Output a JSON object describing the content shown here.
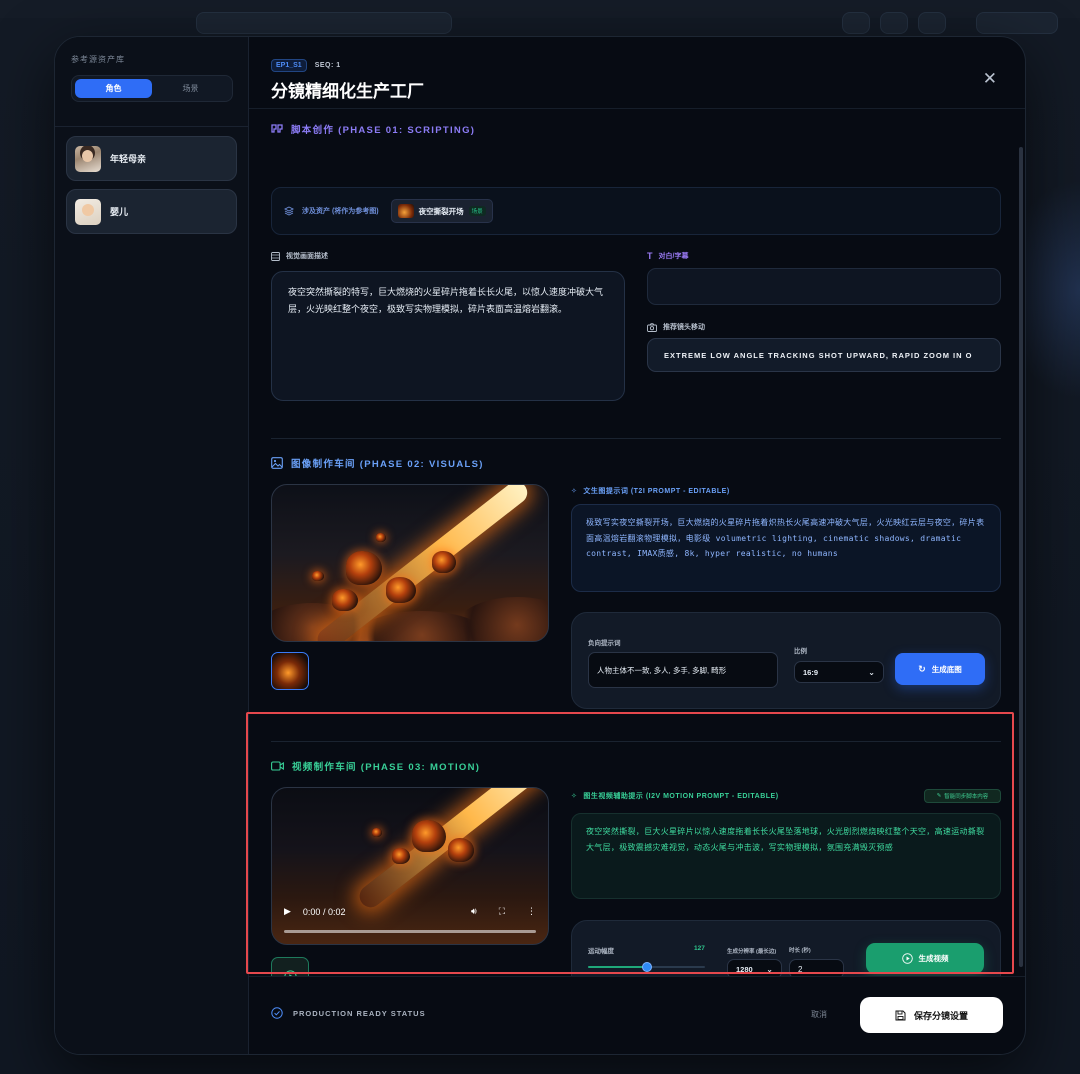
{
  "sidebar": {
    "title": "参考源资产库",
    "tabs": [
      {
        "label": "角色",
        "active": true
      },
      {
        "label": "场景",
        "active": false
      }
    ],
    "assets": [
      {
        "name": "年轻母亲",
        "icon": "avatar-mother"
      },
      {
        "name": "婴儿",
        "icon": "avatar-baby"
      }
    ]
  },
  "header": {
    "ep_badge": "EP1_S1",
    "seq": "SEQ: 1",
    "title": "分镜精细化生产工厂"
  },
  "phase1": {
    "title": "脚本创作 (PHASE 01: SCRIPTING)",
    "refs_label": "涉及资产 (将作为参考图)",
    "ref_chip": {
      "name": "夜空撕裂开场",
      "tag": "场景"
    },
    "visual_label": "视觉画面描述",
    "visual_text": "夜空突然撕裂的特写，巨大燃烧的火星碎片拖着长长火尾，以惊人速度冲破大气层，火光映红整个夜空，极致写实物理模拟，碎片表面高温熔岩翻滚。",
    "dialogue_label": "对白/字幕",
    "dialogue_value": "",
    "camera_label": "推荐镜头移动",
    "camera_value": "EXTREME LOW ANGLE TRACKING SHOT UPWARD, RAPID ZOOM IN O"
  },
  "phase2": {
    "title": "图像制作车间 (PHASE 02: VISUALS)",
    "prompt_label": "文生图提示词 (T2I PROMPT - EDITABLE)",
    "prompt_text": "极致写实夜空撕裂开场，巨大燃烧的火星碎片拖着炽热长火尾高速冲破大气层，火光映红云层与夜空，碎片表面高温熔岩翻滚物理模拟，电影级 volumetric lighting, cinematic shadows, dramatic contrast, IMAX质感, 8k, hyper realistic, no humans",
    "neg_label": "负向提示词",
    "neg_value": "人物主体不一致, 多人, 多手, 多脚, 畸形",
    "ratio_label": "比例",
    "ratio_value": "16:9",
    "generate_label": "生成底图"
  },
  "phase3": {
    "title": "视频制作车间 (PHASE 03: MOTION)",
    "prompt_label": "图生视频辅助提示 (I2V MOTION PROMPT - EDITABLE)",
    "sync_label": "智能同步脚本内容",
    "prompt_text": "夜空突然撕裂，巨大火星碎片以惊人速度拖着长长火尾坠落地球，火光剧烈燃烧映红整个天空，高速运动撕裂大气层，极致震撼灾难视觉，动态火尾与冲击波，写实物理模拟，氛围充满毁灭预感",
    "motion_label": "运动幅度",
    "motion_value": "127",
    "motion_fraction": 0.5,
    "res_label": "生成分辨率 (最长边)",
    "res_value": "1280",
    "duration_label": "时长 (秒)",
    "duration_value": "2",
    "generate_label": "生成视频",
    "video_time": "0:00 / 0:02"
  },
  "footer": {
    "status": "PRODUCTION READY STATUS",
    "cancel": "取消",
    "save": "保存分镜设置"
  }
}
